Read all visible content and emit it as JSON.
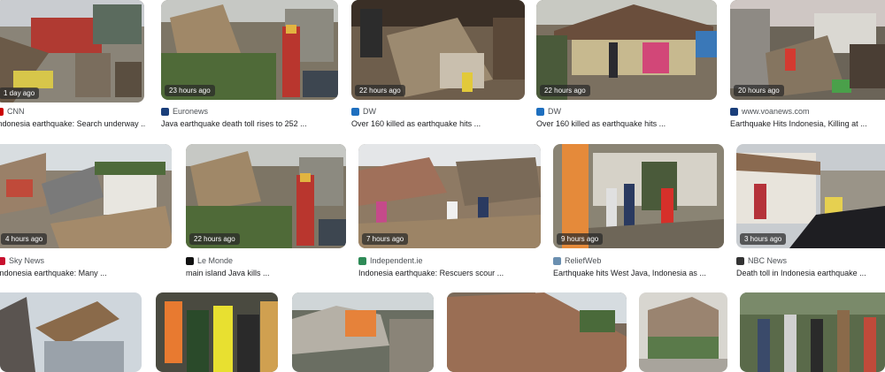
{
  "rows": [
    [
      {
        "time": "1 day ago",
        "source": "CNN",
        "title": "Indonesia earthquake: Search underway ...",
        "icon": "cnn-icon",
        "color": "#cc0000"
      },
      {
        "time": "23 hours ago",
        "source": "Euronews",
        "title": "Java earthquake death toll rises to 252 ...",
        "icon": "euronews-icon",
        "color": "#1a3e7a"
      },
      {
        "time": "22 hours ago",
        "source": "DW",
        "title": "Over 160 killed as earthquake hits ...",
        "icon": "dw-icon",
        "color": "#1e6fbf"
      },
      {
        "time": "22 hours ago",
        "source": "DW",
        "title": "Over 160 killed as earthquake hits ...",
        "icon": "dw-icon",
        "color": "#1e6fbf"
      },
      {
        "time": "20 hours ago",
        "source": "www.voanews.com",
        "title": "Earthquake Hits Indonesia, Killing at ...",
        "icon": "voa-icon",
        "color": "#1a3e7a"
      }
    ],
    [
      {
        "time": "4 hours ago",
        "source": "Sky News",
        "title": "Indonesia earthquake: Many ...",
        "icon": "sky-news-icon",
        "color": "#c8102e"
      },
      {
        "time": "22 hours ago",
        "source": "Le Monde",
        "title": "main island Java kills ...",
        "icon": "le-monde-icon",
        "color": "#111111"
      },
      {
        "time": "7 hours ago",
        "source": "Independent.ie",
        "title": "Indonesia earthquake: Rescuers scour ...",
        "icon": "independent-icon",
        "color": "#2e8b57"
      },
      {
        "time": "9 hours ago",
        "source": "ReliefWeb",
        "title": "Earthquake hits West Java, Indonesia as ...",
        "icon": "reliefweb-icon",
        "color": "#6a8fb0"
      },
      {
        "time": "3 hours ago",
        "source": "NBC News",
        "title": "Death toll in Indonesia earthquake ...",
        "icon": "nbc-news-icon",
        "color": "#333333"
      }
    ]
  ]
}
